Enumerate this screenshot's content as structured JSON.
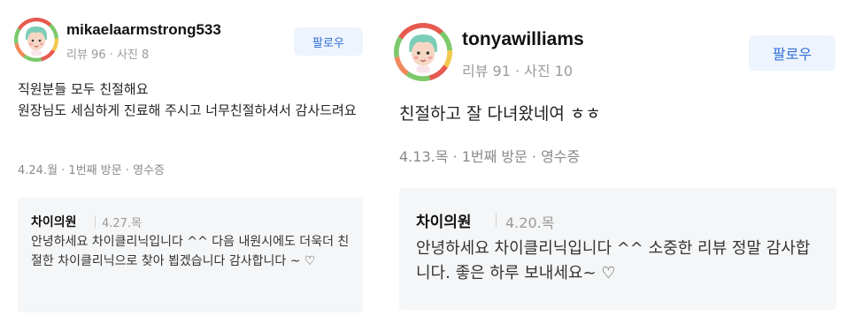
{
  "reviews": [
    {
      "username": "mikaelaarmstrong533",
      "stats": "리뷰 96 · 사진 8",
      "follow_label": "팔로우",
      "body": "직원분들 모두 친절해요\n원장님도 세심하게 진료해 주시고 너무친절하셔서 감사드려요",
      "meta": "4.24.월 · 1번째 방문 · 영수증",
      "reply": {
        "name": "차이의원",
        "date": "4.27.목",
        "text": "안녕하세요 차이클리닉입니다 ^^ 다음 내원시에도 더욱더 친절한 차이클리닉으로 찾아 뵙겠습니다 감사합니다 ~ ♡"
      }
    },
    {
      "username": "tonyawilliams",
      "stats": "리뷰 91 · 사진 10",
      "follow_label": "팔로우",
      "body": "친절하고 잘 다녀왔네여 ㅎㅎ",
      "meta": "4.13.목 · 1번째 방문 · 영수증",
      "reply": {
        "name": "차이의원",
        "date": "4.20.목",
        "text": "안녕하세요 차이클리닉입니다 ^^ 소중한 리뷰 정말 감사합니다. 좋은 하루 보내세요~ ♡"
      }
    }
  ],
  "avatar_icon": "flower-wreath-character-avatar"
}
